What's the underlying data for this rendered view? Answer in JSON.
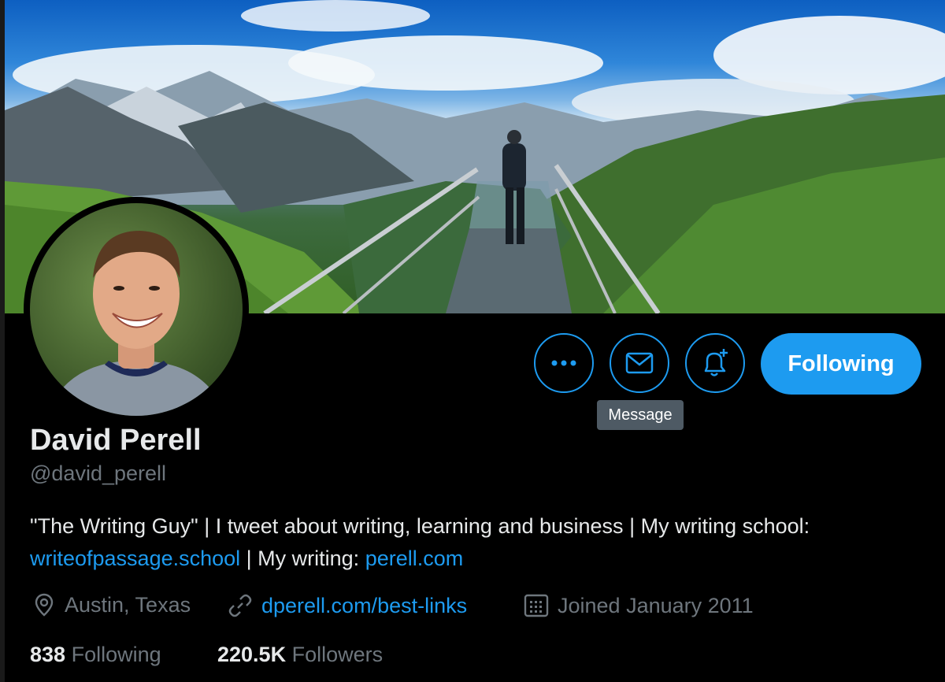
{
  "profile": {
    "name": "David Perell",
    "handle": "@david_perell",
    "bio": {
      "part1": "\"The Writing Guy\" | I tweet about writing, learning and business | My writing school: ",
      "link1": "writeofpassage.school",
      "part2": " | My writing: ",
      "link2": "perell.com"
    },
    "location": "Austin, Texas",
    "website": "dperell.com/best-links",
    "joined": "Joined January 2011",
    "following_count": "838",
    "following_label": "Following",
    "followers_count": "220.5K",
    "followers_label": "Followers"
  },
  "actions": {
    "following_button": "Following",
    "message_tooltip": "Message"
  },
  "icons": [
    "more-icon",
    "mail-icon",
    "bell-plus-icon",
    "location-pin-icon",
    "link-icon",
    "calendar-icon"
  ],
  "colors": {
    "accent": "#1d9bf0",
    "background": "#000000",
    "muted": "#6e767d",
    "tooltip": "#4e5a64"
  }
}
